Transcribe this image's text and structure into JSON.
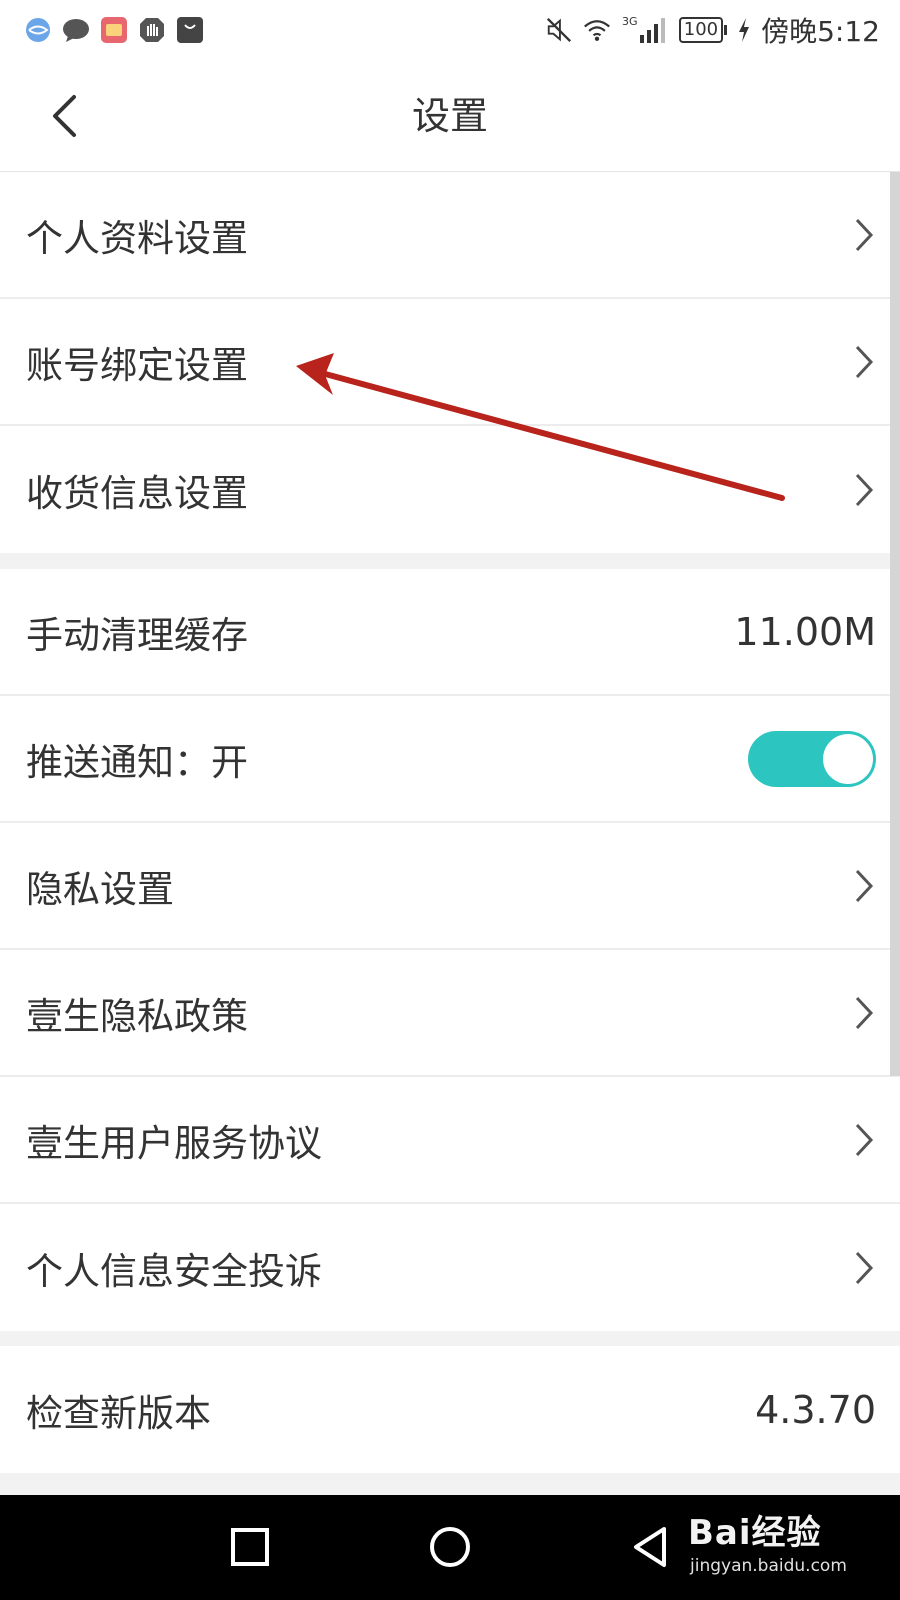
{
  "status_bar": {
    "time": "傍晚5:12",
    "battery": "100",
    "network": "3G",
    "notification_icons": [
      "browser-icon",
      "message-icon",
      "huawei-app-icon",
      "hand-icon",
      "huawei-store-icon"
    ],
    "system_icons": [
      "mute-icon",
      "wifi-icon",
      "signal-icon",
      "battery-icon",
      "charging-icon"
    ]
  },
  "header": {
    "title": "设置"
  },
  "sections": [
    {
      "rows": [
        {
          "label": "个人资料设置",
          "chevron": true
        },
        {
          "label": "账号绑定设置",
          "chevron": true
        },
        {
          "label": "收货信息设置",
          "chevron": true
        }
      ]
    },
    {
      "rows": [
        {
          "label": "手动清理缓存",
          "value": "11.00M"
        },
        {
          "label": "推送通知：开",
          "toggle_on": true
        },
        {
          "label": "隐私设置",
          "chevron": true
        },
        {
          "label": "壹生隐私政策",
          "chevron": true
        },
        {
          "label": "壹生用户服务协议",
          "chevron": true
        },
        {
          "label": "个人信息安全投诉",
          "chevron": true
        }
      ]
    },
    {
      "rows": [
        {
          "label": "检查新版本",
          "value": "4.3.70"
        }
      ]
    }
  ],
  "colors": {
    "toggle_on": "#2dc5c0",
    "annotation_arrow": "#b8231c",
    "page_background": "#f2f2f2"
  },
  "watermark": {
    "logo": "Bai经验",
    "url": "jingyan.baidu.com"
  }
}
